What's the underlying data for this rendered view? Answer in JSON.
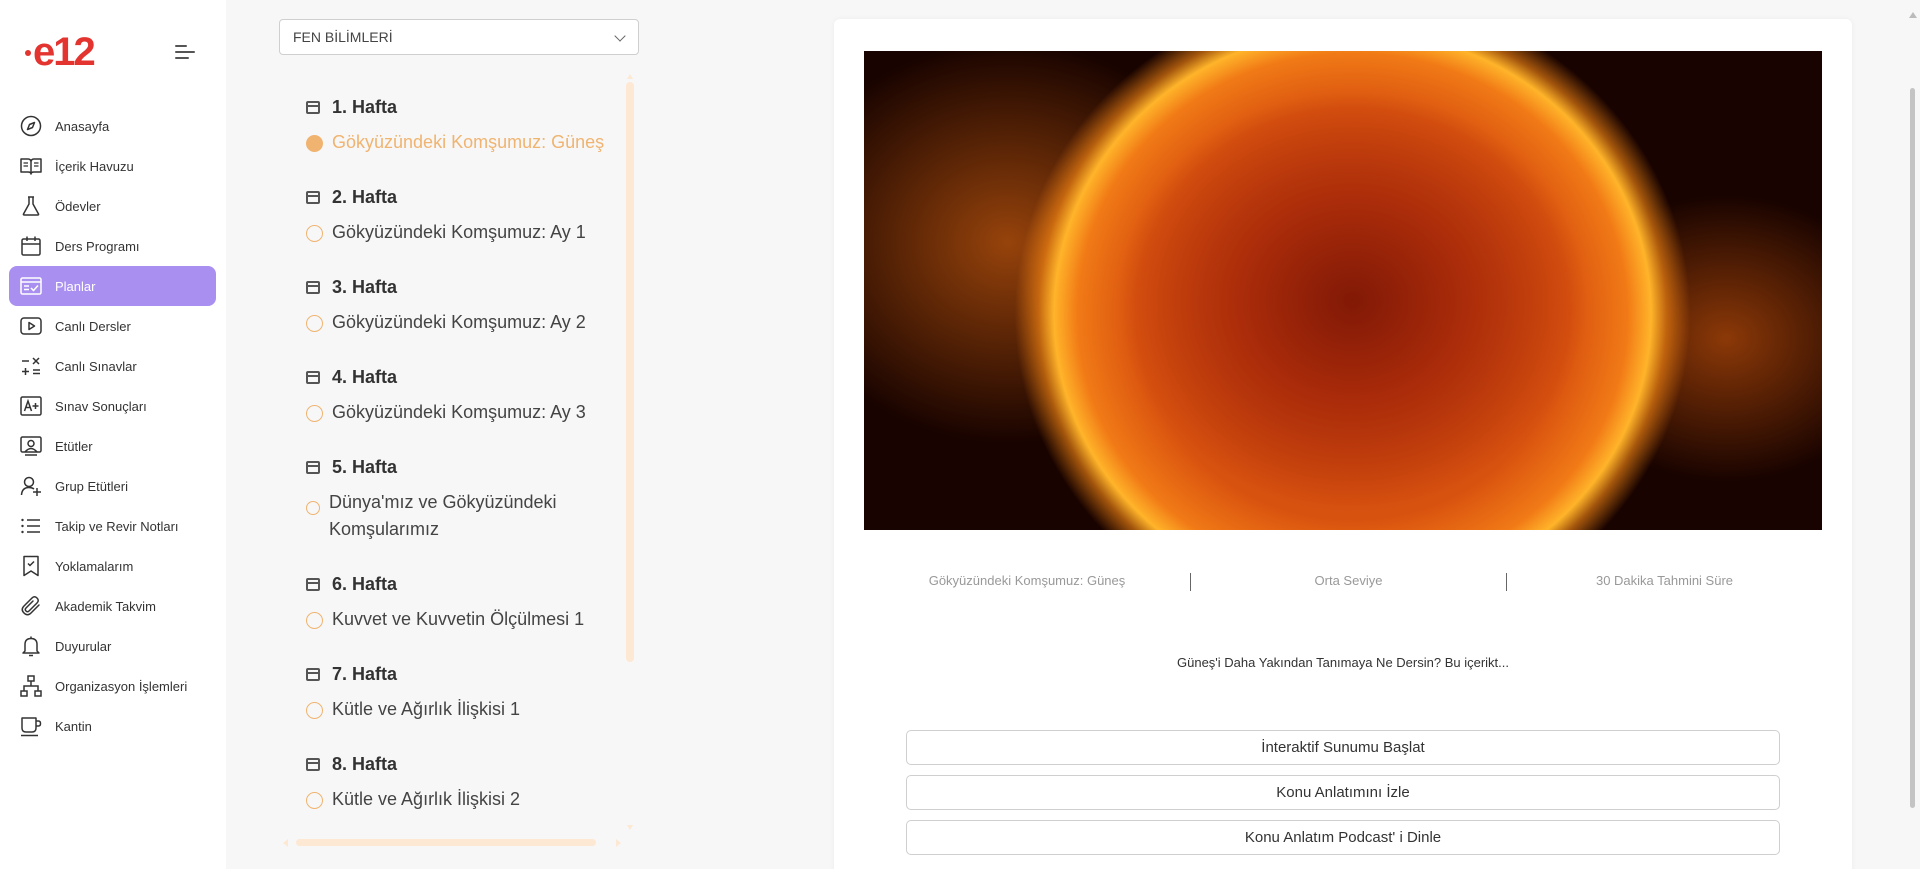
{
  "logo": {
    "text": "e12",
    "color": "#e3342f"
  },
  "sidebar": {
    "items": [
      {
        "label": "Anasayfa",
        "icon": "compass-icon"
      },
      {
        "label": "İçerik Havuzu",
        "icon": "open-book-icon"
      },
      {
        "label": "Ödevler",
        "icon": "flask-icon"
      },
      {
        "label": "Ders Programı",
        "icon": "calendar-icon"
      },
      {
        "label": "Planlar",
        "icon": "calendar-check-icon",
        "active": true
      },
      {
        "label": "Canlı Dersler",
        "icon": "play-icon"
      },
      {
        "label": "Canlı Sınavlar",
        "icon": "math-symbols-icon"
      },
      {
        "label": "Sınav Sonuçları",
        "icon": "grade-a-plus-icon"
      },
      {
        "label": "Etütler",
        "icon": "study-icon"
      },
      {
        "label": "Grup Etütleri",
        "icon": "user-plus-icon"
      },
      {
        "label": "Takip ve Revir Notları",
        "icon": "list-icon"
      },
      {
        "label": "Yoklamalarım",
        "icon": "bookmark-check-icon"
      },
      {
        "label": "Akademik Takvim",
        "icon": "paperclip-icon"
      },
      {
        "label": "Duyurular",
        "icon": "bell-icon"
      },
      {
        "label": "Organizasyon İşlemleri",
        "icon": "org-chart-icon"
      },
      {
        "label": "Kantin",
        "icon": "cup-icon"
      }
    ],
    "active_color": "#a98ff0"
  },
  "subject_select": {
    "value": "FEN BİLİMLERİ"
  },
  "weeks": [
    {
      "title": "1. Hafta",
      "lesson": "Gökyüzündeki Komşumuz: Güneş",
      "active": true
    },
    {
      "title": "2. Hafta",
      "lesson": "Gökyüzündeki Komşumuz: Ay 1"
    },
    {
      "title": "3. Hafta",
      "lesson": "Gökyüzündeki Komşumuz: Ay 2"
    },
    {
      "title": "4. Hafta",
      "lesson": "Gökyüzündeki Komşumuz: Ay 3"
    },
    {
      "title": "5. Hafta",
      "lesson": "Dünya'mız ve Gökyüzündeki Komşularımız"
    },
    {
      "title": "6. Hafta",
      "lesson": "Kuvvet ve Kuvvetin Ölçülmesi 1"
    },
    {
      "title": "7. Hafta",
      "lesson": "Kütle ve Ağırlık İlişkisi 1"
    },
    {
      "title": "8. Hafta",
      "lesson": "Kütle ve Ağırlık İlişkisi 2"
    }
  ],
  "accent_color": "#f0b470",
  "content": {
    "topic": "Gökyüzündeki Komşumuz: Güneş",
    "level": "Orta Seviye",
    "duration": "30 Dakika Tahmini Süre",
    "description": "Güneş'i Daha Yakından Tanımaya Ne Dersin? Bu içerikt...",
    "buttons": [
      "İnteraktif Sunumu Başlat",
      "Konu Anlatımını İzle",
      "Konu Anlatım Podcast' i Dinle"
    ]
  }
}
